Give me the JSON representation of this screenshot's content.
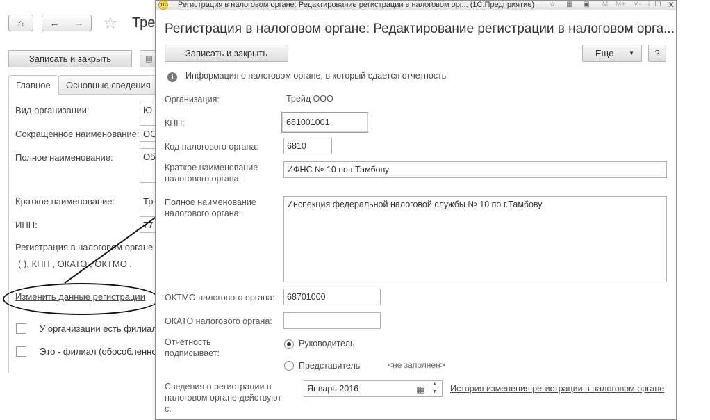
{
  "background_form": {
    "title": "Тре",
    "save_close_label": "Записать и закрыть",
    "tabs": [
      {
        "label": "Главное"
      },
      {
        "label": "Основные сведения"
      }
    ],
    "fields": [
      {
        "label": "Вид организации:",
        "value": "Ю"
      },
      {
        "label": "Сокращенное наименование:",
        "value": "ОО"
      },
      {
        "label": "Полное наименование:",
        "value": "Об"
      },
      {
        "label": "Краткое наименование:",
        "value": "Тр"
      },
      {
        "label": "ИНН:",
        "value": "77"
      }
    ],
    "registration_label": "Регистрация в налоговом органе",
    "registration_summary": "(    ), КПП , ОКАТО , ОКТМО .",
    "change_registration_link": "Изменить данные регистрации",
    "checkboxes": [
      {
        "label": "У организации есть филиал"
      },
      {
        "label": "Это - филиал (обособленно"
      }
    ]
  },
  "dialog": {
    "window_title": "Регистрация в налоговом органе: Редактирование регистрации в налоговом орг...  (1С:Предприятие)",
    "heading": "Регистрация в налоговом органе: Редактирование регистрации в налоговом орга...",
    "save_close_label": "Записать и закрыть",
    "more_label": "Еще",
    "help_label": "?",
    "info_text": "Информация о налоговом органе, в который сдается отчетность",
    "organization": {
      "label": "Организация:",
      "value": "Трейд ООО"
    },
    "kpp": {
      "label": "КПП:",
      "value": "681001001"
    },
    "tax_office_code": {
      "label": "Код налогового органа:",
      "value": "6810"
    },
    "short_name": {
      "label": "Краткое наименование налогового органа:",
      "value": "ИФНС № 10 по г.Тамбову"
    },
    "full_name": {
      "label": "Полное наименование налогового органа:",
      "value": "Инспекция федеральной налоговой службы № 10 по г.Тамбову"
    },
    "oktmo": {
      "label": "ОКТМО налогового органа:",
      "value": "68701000"
    },
    "okato": {
      "label": "ОКАТО налогового органа:",
      "value": ""
    },
    "signer": {
      "label": "Отчетность подписывает:",
      "options": [
        {
          "label": "Руководитель",
          "selected": true
        },
        {
          "label": "Представитель",
          "selected": false
        }
      ],
      "representative_hint": "<не заполнен>"
    },
    "valid_from": {
      "label": "Сведения о регистрации в налоговом органе действуют с:",
      "value": "Январь 2016"
    },
    "history_link": "История изменения регистрации  в налоговом органе"
  }
}
